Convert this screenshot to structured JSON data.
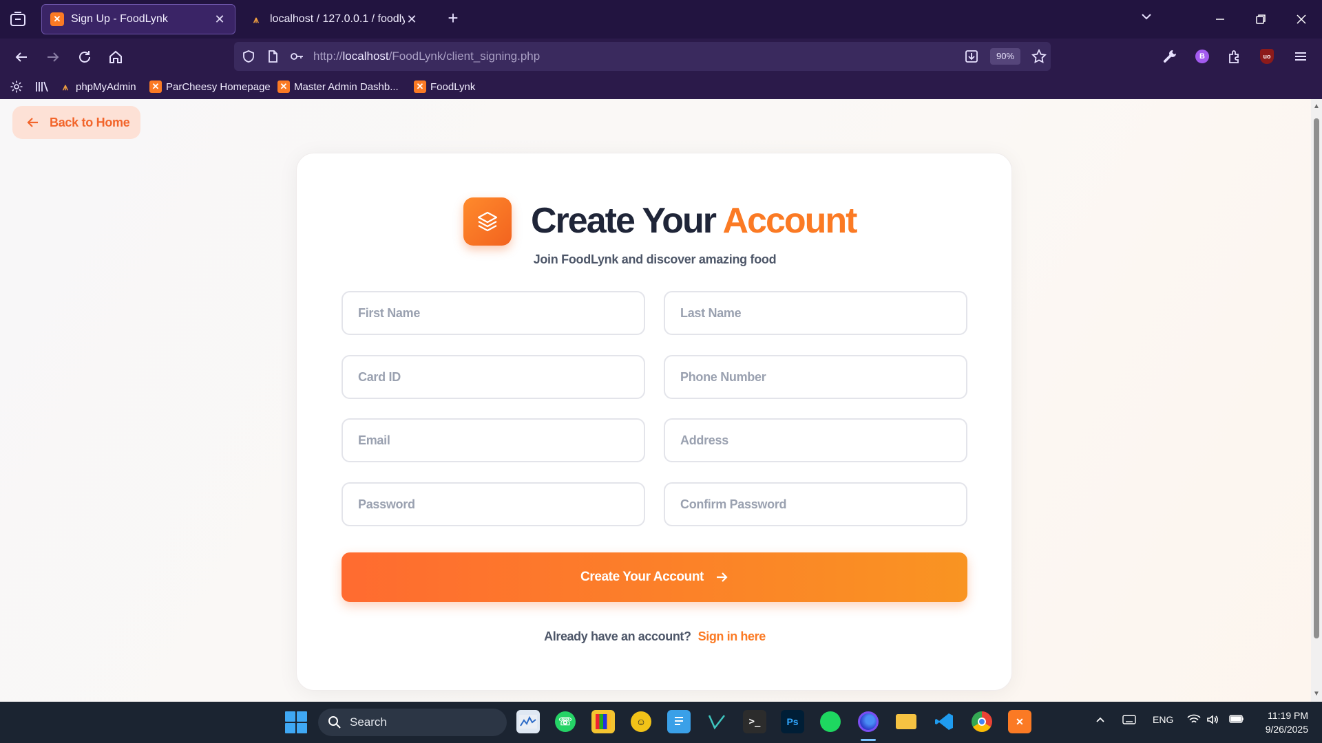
{
  "browser": {
    "tabs": [
      {
        "title": "Sign Up - FoodLynk",
        "favicon": "xampp-icon",
        "active": true
      },
      {
        "title": "localhost / 127.0.0.1 / foodlynk /",
        "favicon": "phpmyadmin-icon",
        "active": false
      }
    ],
    "url": {
      "prefix": "http://",
      "host": "localhost",
      "path": "/FoodLynk/client_signing.php"
    },
    "zoom": "90%",
    "profile_initial": "B",
    "bookmarks": [
      {
        "label": "phpMyAdmin",
        "favicon": "phpmyadmin-icon"
      },
      {
        "label": "ParCheesy Homepage",
        "favicon": "xampp-icon"
      },
      {
        "label": "Master Admin Dashb...",
        "favicon": "xampp-icon"
      },
      {
        "label": "FoodLynk",
        "favicon": "xampp-icon"
      }
    ]
  },
  "page": {
    "back_label": "Back to Home",
    "title_main": "Create Your",
    "title_accent": "Account",
    "subtitle": "Join FoodLynk and discover amazing food",
    "fields": {
      "first_name": "First Name",
      "last_name": "Last Name",
      "card_id": "Card ID",
      "phone": "Phone Number",
      "email": "Email",
      "address": "Address",
      "password": "Password",
      "confirm_password": "Confirm Password"
    },
    "submit_label": "Create Your Account",
    "signin_prompt": "Already have an account?",
    "signin_link": "Sign in here",
    "colors": {
      "accent": "#fb7a24",
      "title": "#1f2538"
    }
  },
  "taskbar": {
    "search_label": "Search",
    "language": "ENG",
    "time": "11:19 PM",
    "date": "9/26/2025"
  }
}
